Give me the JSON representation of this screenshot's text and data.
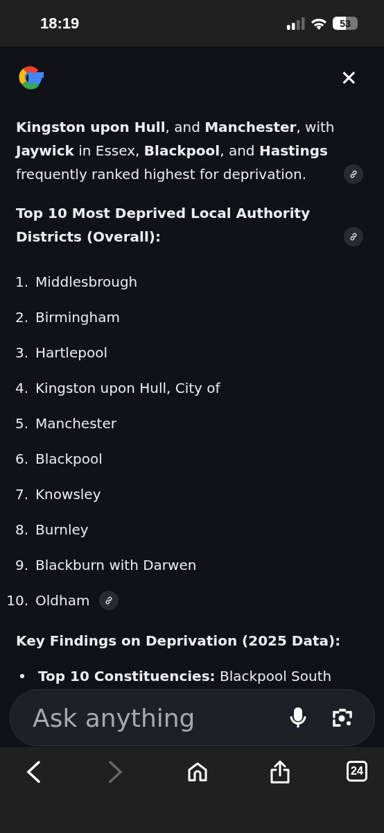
{
  "status_bar": {
    "time": "18:19",
    "battery": {
      "text": "53",
      "level": 0.53
    }
  },
  "header": {
    "close": "✕"
  },
  "content": {
    "paragraph": {
      "text": "**Kingston upon Hull**, and **Manchester**, with **Jaywick** in Essex, **Blackpool**, and **Hastings** frequently ranked highest for deprivation.",
      "source_link": true
    },
    "list_heading": {
      "text": "Top 10 Most Deprived Local Authority Districts (Overall):",
      "source_link": true
    },
    "list": [
      {
        "number": "1.",
        "text": "Middlesbrough",
        "source_link": false
      },
      {
        "number": "2.",
        "text": "Birmingham",
        "source_link": false
      },
      {
        "number": "3.",
        "text": "Hartlepool",
        "source_link": false
      },
      {
        "number": "4.",
        "text": "Kingston upon Hull, City of",
        "source_link": false
      },
      {
        "number": "5.",
        "text": "Manchester",
        "source_link": false
      },
      {
        "number": "6.",
        "text": "Blackpool",
        "source_link": false
      },
      {
        "number": "7.",
        "text": "Knowsley",
        "source_link": false
      },
      {
        "number": "8.",
        "text": "Burnley",
        "source_link": false
      },
      {
        "number": "9.",
        "text": "Blackburn with Darwen",
        "source_link": false
      },
      {
        "number": "10.",
        "text": "Oldham",
        "source_link": true
      }
    ],
    "findings_heading": {
      "text": "Key Findings on Deprivation (2025 Data):"
    },
    "bullets": [
      {
        "text": "**Top 10 Constituencies:** Blackpool South"
      }
    ]
  },
  "ask_bar": {
    "placeholder": "Ask anything"
  },
  "toolbar": {
    "back_disabled": false,
    "forward_disabled": true,
    "tab_count": "24"
  }
}
